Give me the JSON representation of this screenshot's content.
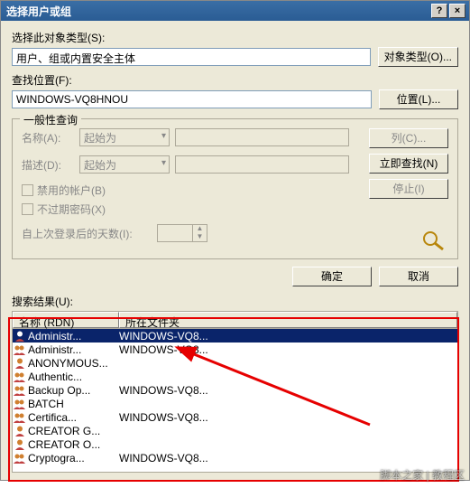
{
  "titlebar": {
    "title": "选择用户或组",
    "help": "?",
    "close": "×"
  },
  "objtype": {
    "label": "选择此对象类型(S):",
    "value": "用户、组或内置安全主体",
    "button": "对象类型(O)..."
  },
  "location": {
    "label": "查找位置(F):",
    "value": "WINDOWS-VQ8HNOU",
    "button": "位置(L)..."
  },
  "common": {
    "legend": "一般性查询",
    "name_label": "名称(A):",
    "name_combo": "起始为",
    "desc_label": "描述(D):",
    "desc_combo": "起始为",
    "chk_disabled": "禁用的帐户(B)",
    "chk_noexpire": "不过期密码(X)",
    "days_label": "自上次登录后的天数(I):",
    "btn_columns": "列(C)...",
    "btn_findnow": "立即查找(N)",
    "btn_stop": "停止(I)"
  },
  "buttons": {
    "ok": "确定",
    "cancel": "取消"
  },
  "results": {
    "label": "搜索结果(U):",
    "col_name": "名称 (RDN)",
    "col_folder": "所在文件夹",
    "rows": [
      {
        "name": "Administr...",
        "folder": "WINDOWS-VQ8...",
        "selected": true,
        "type": "user"
      },
      {
        "name": "Administr...",
        "folder": "WINDOWS-VQ8...",
        "type": "group"
      },
      {
        "name": "ANONYMOUS...",
        "folder": "",
        "type": "user"
      },
      {
        "name": "Authentic...",
        "folder": "",
        "type": "group"
      },
      {
        "name": "Backup Op...",
        "folder": "WINDOWS-VQ8...",
        "type": "group"
      },
      {
        "name": "BATCH",
        "folder": "",
        "type": "group"
      },
      {
        "name": "Certifica...",
        "folder": "WINDOWS-VQ8...",
        "type": "group"
      },
      {
        "name": "CREATOR G...",
        "folder": "",
        "type": "user"
      },
      {
        "name": "CREATOR O...",
        "folder": "",
        "type": "user"
      },
      {
        "name": "Cryptogra...",
        "folder": "WINDOWS-VQ8...",
        "type": "group"
      }
    ]
  },
  "watermark": "脚本之家 | 教程区"
}
